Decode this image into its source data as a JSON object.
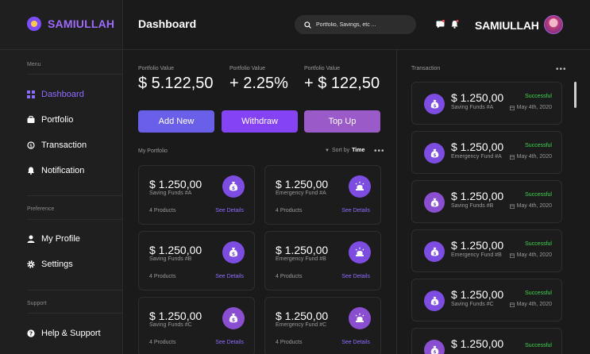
{
  "brand": {
    "name": "SAMIULLAH"
  },
  "sidebar": {
    "menu_label": "Menu",
    "menu_items": [
      {
        "label": "Dashboard",
        "icon": "grid-icon"
      },
      {
        "label": "Portfolio",
        "icon": "briefcase-icon"
      },
      {
        "label": "Transaction",
        "icon": "transaction-icon"
      },
      {
        "label": "Notification",
        "icon": "bell-icon"
      }
    ],
    "preference_label": "Preference",
    "preference_items": [
      {
        "label": "My Profile",
        "icon": "user-icon"
      },
      {
        "label": "Settings",
        "icon": "gear-icon"
      }
    ],
    "support_label": "Support",
    "support_items": [
      {
        "label": "Help & Support",
        "icon": "help-icon"
      }
    ]
  },
  "header": {
    "title": "Dashboard",
    "search_placeholder": "Portfolio, Savings, etc ...",
    "user_name": "SAMIULLAH"
  },
  "stats": [
    {
      "label": "Portfolio Value",
      "value": "$ 5.122,50"
    },
    {
      "label": "Portfolio Value",
      "value": "+ 2.25%"
    },
    {
      "label": "Portfolio Value",
      "value": "+ $ 122,50"
    }
  ],
  "actions": {
    "add": "Add New",
    "withdraw": "Withdraw",
    "topup": "Top Up"
  },
  "portfolio": {
    "label": "My Portfolio",
    "sort_prefix": "Sort by",
    "sort_value": "Time",
    "cards": [
      {
        "amount": "$ 1.250,00",
        "name": "Saving Funds #A",
        "products": "4 Products",
        "link": "See Details",
        "icon": "money-bag-icon"
      },
      {
        "amount": "$ 1.250,00",
        "name": "Emergency Fund #A",
        "products": "4 Products",
        "link": "See Details",
        "icon": "siren-icon"
      },
      {
        "amount": "$ 1.250,00",
        "name": "Saving Funds #B",
        "products": "4 Products",
        "link": "See Details",
        "icon": "money-bag-icon"
      },
      {
        "amount": "$ 1.250,00",
        "name": "Emergency Fund #B",
        "products": "4 Products",
        "link": "See Details",
        "icon": "siren-icon"
      },
      {
        "amount": "$ 1.250,00",
        "name": "Saving Funds #C",
        "products": "4 Products",
        "link": "See Details",
        "icon": "money-bag-icon"
      },
      {
        "amount": "$ 1.250,00",
        "name": "Emergency Fund #C",
        "products": "4 Products",
        "link": "See Details",
        "icon": "siren-icon"
      }
    ]
  },
  "transactions": {
    "label": "Transaction",
    "items": [
      {
        "amount": "$ 1.250,00",
        "name": "Saving Funds #A",
        "status": "Successful",
        "date": "May 4th, 2020"
      },
      {
        "amount": "$ 1.250,00",
        "name": "Emergency Fund #A",
        "status": "Successful",
        "date": "May 4th, 2020"
      },
      {
        "amount": "$ 1.250,00",
        "name": "Saving Funds #B",
        "status": "Successful",
        "date": "May 4th, 2020"
      },
      {
        "amount": "$ 1.250,00",
        "name": "Emergency Fund #B",
        "status": "Successful",
        "date": "May 4th, 2020"
      },
      {
        "amount": "$ 1.250,00",
        "name": "Saving Funds #C",
        "status": "Successful",
        "date": "May 4th, 2020"
      },
      {
        "amount": "$ 1.250,00",
        "name": "",
        "status": "Successful",
        "date": ""
      }
    ]
  },
  "colors": {
    "accent": "#8e6cff",
    "success": "#3dd54e",
    "background": "#1a1a1a"
  }
}
